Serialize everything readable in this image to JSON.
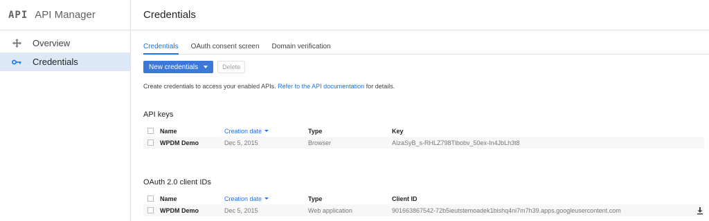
{
  "sidebar": {
    "logo": "API",
    "app_name": "API Manager",
    "items": [
      {
        "label": "Overview",
        "icon": "move-arrows-icon"
      },
      {
        "label": "Credentials",
        "icon": "key-icon",
        "active": true
      }
    ]
  },
  "header": {
    "title": "Credentials"
  },
  "tabs": [
    {
      "label": "Credentials",
      "active": true
    },
    {
      "label": "OAuth consent screen"
    },
    {
      "label": "Domain verification"
    }
  ],
  "toolbar": {
    "new_label": "New credentials",
    "delete_label": "Delete"
  },
  "description": {
    "prefix": "Create credentials to access your enabled APIs. ",
    "link": "Refer to the API documentation",
    "suffix": " for details."
  },
  "api_keys": {
    "title": "API keys",
    "columns": [
      "Name",
      "Creation date",
      "Type",
      "Key"
    ],
    "rows": [
      {
        "name": "WPDM Demo",
        "date": "Dec 5, 2015",
        "type": "Browser",
        "key": "AIzaSyB_s-RHLZ798Tlbobv_50ex-In4JbLh3t8"
      }
    ]
  },
  "oauth": {
    "title": "OAuth 2.0 client IDs",
    "columns": [
      "Name",
      "Creation date",
      "Type",
      "Client ID"
    ],
    "rows": [
      {
        "name": "WPDM Demo",
        "date": "Dec 5, 2015",
        "type": "Web application",
        "client_id": "901663867542-72b5ieutstemoadek1bishq4ni7m7h39.apps.googleusercontent.com"
      }
    ]
  },
  "colors": {
    "accent": "#1a73e8",
    "button": "#3c78d8",
    "active_nav": "#dde8f7"
  }
}
